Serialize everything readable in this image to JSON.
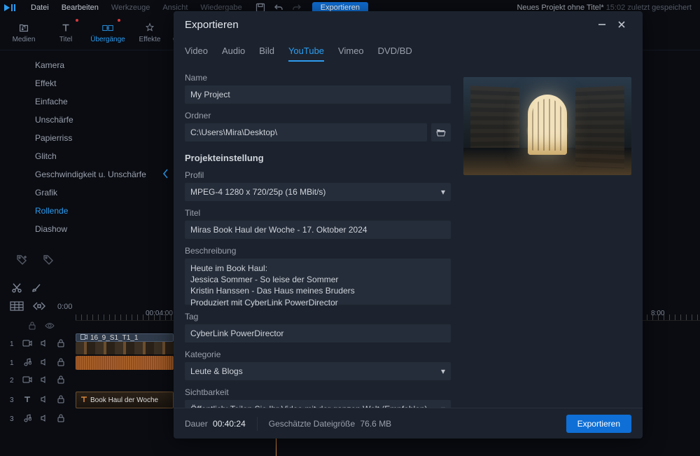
{
  "menubar": {
    "items": [
      "Datei",
      "Bearbeiten",
      "Werkzeuge",
      "Ansicht",
      "Wiedergabe"
    ],
    "dim_from_index": 2,
    "export_label": "Exportieren",
    "project_title": "Neues Projekt ohne Titel*",
    "last_saved": "15:02 zuletzt gespeichert"
  },
  "toolbar": {
    "tabs": [
      {
        "label": "Medien",
        "icon": "music"
      },
      {
        "label": "Titel",
        "icon": "text",
        "dot": true
      },
      {
        "label": "Übergänge",
        "icon": "transition",
        "active": true,
        "dot": true
      },
      {
        "label": "Effekte",
        "icon": "sparkle"
      },
      {
        "label": "Overlay",
        "icon": "layer"
      }
    ]
  },
  "sidebar": {
    "items": [
      "Kamera",
      "Effekt",
      "Einfache",
      "Unschärfe",
      "Papierriss",
      "Glitch",
      "Geschwindigkeit u. Unschärfe",
      "Grafik",
      "Rollende",
      "Diashow"
    ],
    "selected_index": 8
  },
  "timeline": {
    "ruler_start": "0:00",
    "ruler_marks": [
      "00:04:00",
      "8:00"
    ],
    "clip_video": "16_9_S1_T1_1",
    "clip_title": "Book Haul der Woche"
  },
  "modal": {
    "title": "Exportieren",
    "tabs": [
      "Video",
      "Audio",
      "Bild",
      "YouTube",
      "Vimeo",
      "DVD/BD"
    ],
    "active_tab_index": 3,
    "fields": {
      "name_label": "Name",
      "name_value": "My Project",
      "folder_label": "Ordner",
      "folder_value": "C:\\Users\\Mira\\Desktop\\",
      "project_settings": "Projekteinstellung",
      "profile_label": "Profil",
      "profile_value": "MPEG-4 1280 x 720/25p (16 MBit/s)",
      "title_label": "Titel",
      "title_value": "Miras Book Haul der Woche - 17. Oktober 2024",
      "description_label": "Beschreibung",
      "description_value": "Heute im Book Haul:\nJessica Sommer - So leise der Sommer\nKristin Hanssen - Das Haus meines Bruders\nProduziert mit CyberLink PowerDirector",
      "tag_label": "Tag",
      "tag_value": "CyberLink PowerDirector",
      "category_label": "Kategorie",
      "category_value": "Leute & Blogs",
      "visibility_label": "Sichtbarkeit",
      "visibility_value": "Öffentlich: Teilen Sie Ihr Video mit der ganzen Welt (Empfohlen)"
    },
    "footer": {
      "duration_label": "Dauer",
      "duration_value": "00:40:24",
      "size_label": "Geschätzte Dateigröße",
      "size_value": "76.6 MB",
      "action": "Exportieren"
    }
  }
}
